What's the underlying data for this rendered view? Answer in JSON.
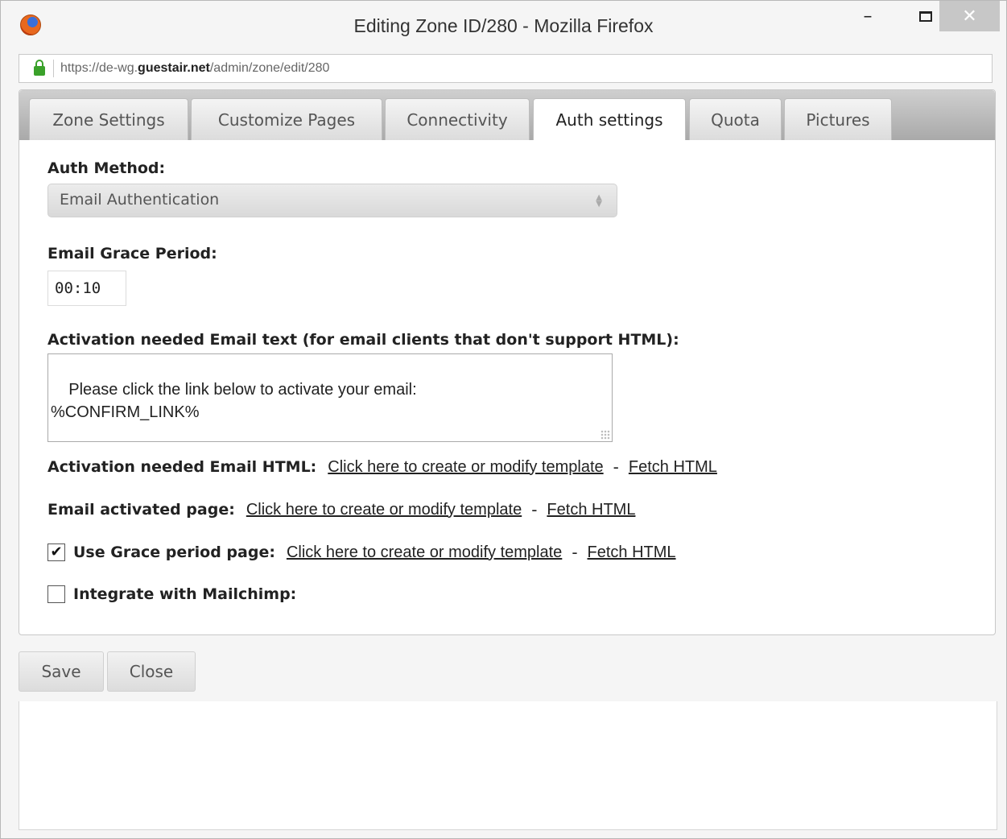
{
  "window": {
    "title": "Editing Zone ID/280 - Mozilla Firefox",
    "minimize_glyph": "–",
    "close_glyph": "✕"
  },
  "address": {
    "url_prefix": "https://de-wg.",
    "url_domain": "guestair.net",
    "url_path": "/admin/zone/edit/280"
  },
  "tabs": [
    {
      "label": "Zone Settings"
    },
    {
      "label": "Customize Pages"
    },
    {
      "label": "Connectivity"
    },
    {
      "label": "Auth settings"
    },
    {
      "label": "Quota"
    },
    {
      "label": "Pictures"
    }
  ],
  "form": {
    "auth_method_label": "Auth Method:",
    "auth_method_value": "Email Authentication",
    "grace_period_label": "Email Grace Period:",
    "grace_period_value": "00:10",
    "activation_text_label": "Activation needed Email text (for email clients that don't support HTML):",
    "activation_text_value": "Please click the link below to activate your email:\n%CONFIRM_LINK%",
    "activation_html_label": "Activation needed Email HTML:",
    "activated_page_label": "Email activated page:",
    "grace_page_label": "Use Grace period page:",
    "grace_page_checked": true,
    "mailchimp_label": "Integrate with Mailchimp:",
    "mailchimp_checked": false,
    "template_link": "Click here to create or modify template",
    "dash": "-",
    "fetch_link": "Fetch HTML",
    "check_glyph": "✔"
  },
  "buttons": {
    "save": "Save",
    "close": "Close"
  }
}
